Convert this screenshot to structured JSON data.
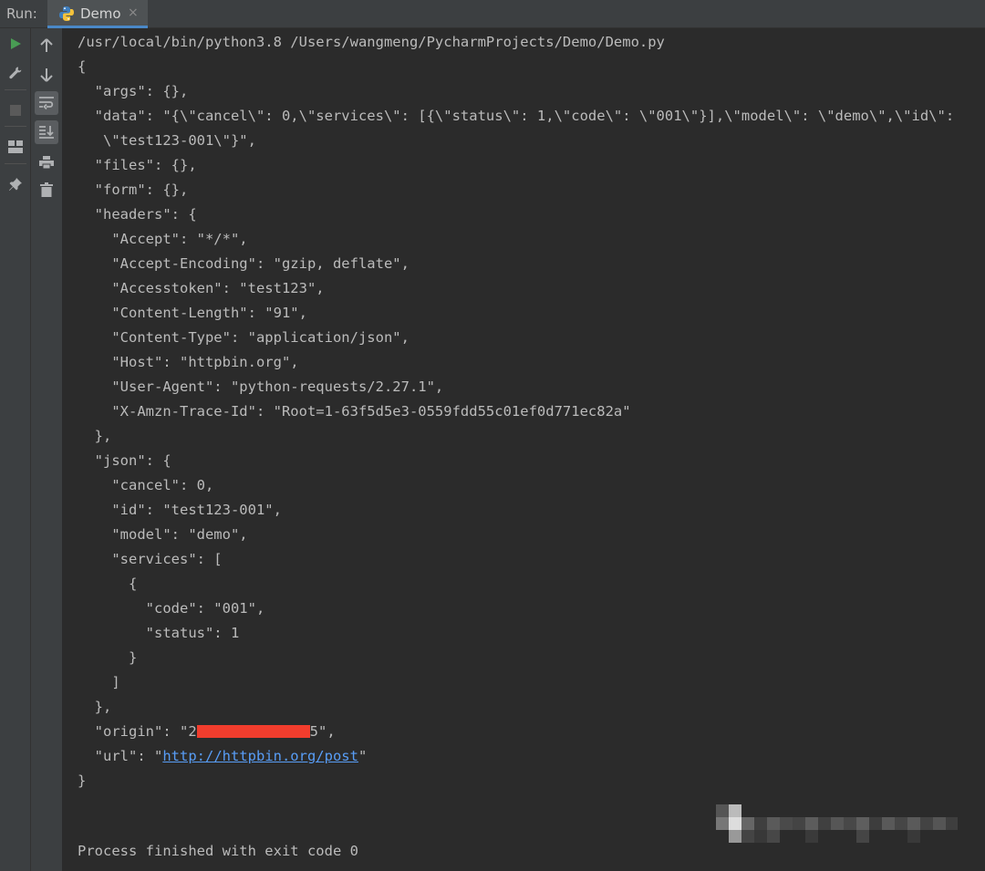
{
  "run_panel": {
    "label": "Run:",
    "tab": {
      "label": "Demo",
      "close": "×"
    }
  },
  "toolbar": {
    "left": [
      "run-icon",
      "wrench-icon",
      "stop-icon",
      "layout-icon",
      "pin-icon"
    ],
    "right": [
      "arrow-up-icon",
      "arrow-down-icon",
      "soft-wrap-icon",
      "scroll-to-end-icon",
      "print-icon",
      "trash-icon"
    ]
  },
  "colors": {
    "text": "#bbbbbb",
    "link": "#589df6",
    "redaction": "#f23d2d",
    "run_green": "#499c54"
  },
  "console": {
    "command": "/usr/local/bin/python3.8 /Users/wangmeng/PycharmProjects/Demo/Demo.py",
    "lines": [
      "{",
      "  \"args\": {},",
      "  \"data\": \"{\\\"cancel\\\": 0,\\\"services\\\": [{\\\"status\\\": 1,\\\"code\\\": \\\"001\\\"}],\\\"model\\\": \\\"demo\\\",\\\"id\\\":",
      "   \\\"test123-001\\\"}\",",
      "  \"files\": {},",
      "  \"form\": {},",
      "  \"headers\": {",
      "    \"Accept\": \"*/*\",",
      "    \"Accept-Encoding\": \"gzip, deflate\",",
      "    \"Accesstoken\": \"test123\",",
      "    \"Content-Length\": \"91\",",
      "    \"Content-Type\": \"application/json\",",
      "    \"Host\": \"httpbin.org\",",
      "    \"User-Agent\": \"python-requests/2.27.1\",",
      "    \"X-Amzn-Trace-Id\": \"Root=1-63f5d5e3-0559fdd55c01ef0d771ec82a\"",
      "  },",
      "  \"json\": {",
      "    \"cancel\": 0,",
      "    \"id\": \"test123-001\",",
      "    \"model\": \"demo\",",
      "    \"services\": [",
      "      {",
      "        \"code\": \"001\",",
      "        \"status\": 1",
      "      }",
      "    ]",
      "  },"
    ],
    "origin_prefix": "  \"origin\": \"2",
    "origin_suffix": "5\",",
    "url_prefix": "  \"url\": \"",
    "url_link": "http://httpbin.org/post",
    "url_suffix": "\"",
    "close_brace": "}",
    "finish": "Process finished with exit code 0"
  }
}
